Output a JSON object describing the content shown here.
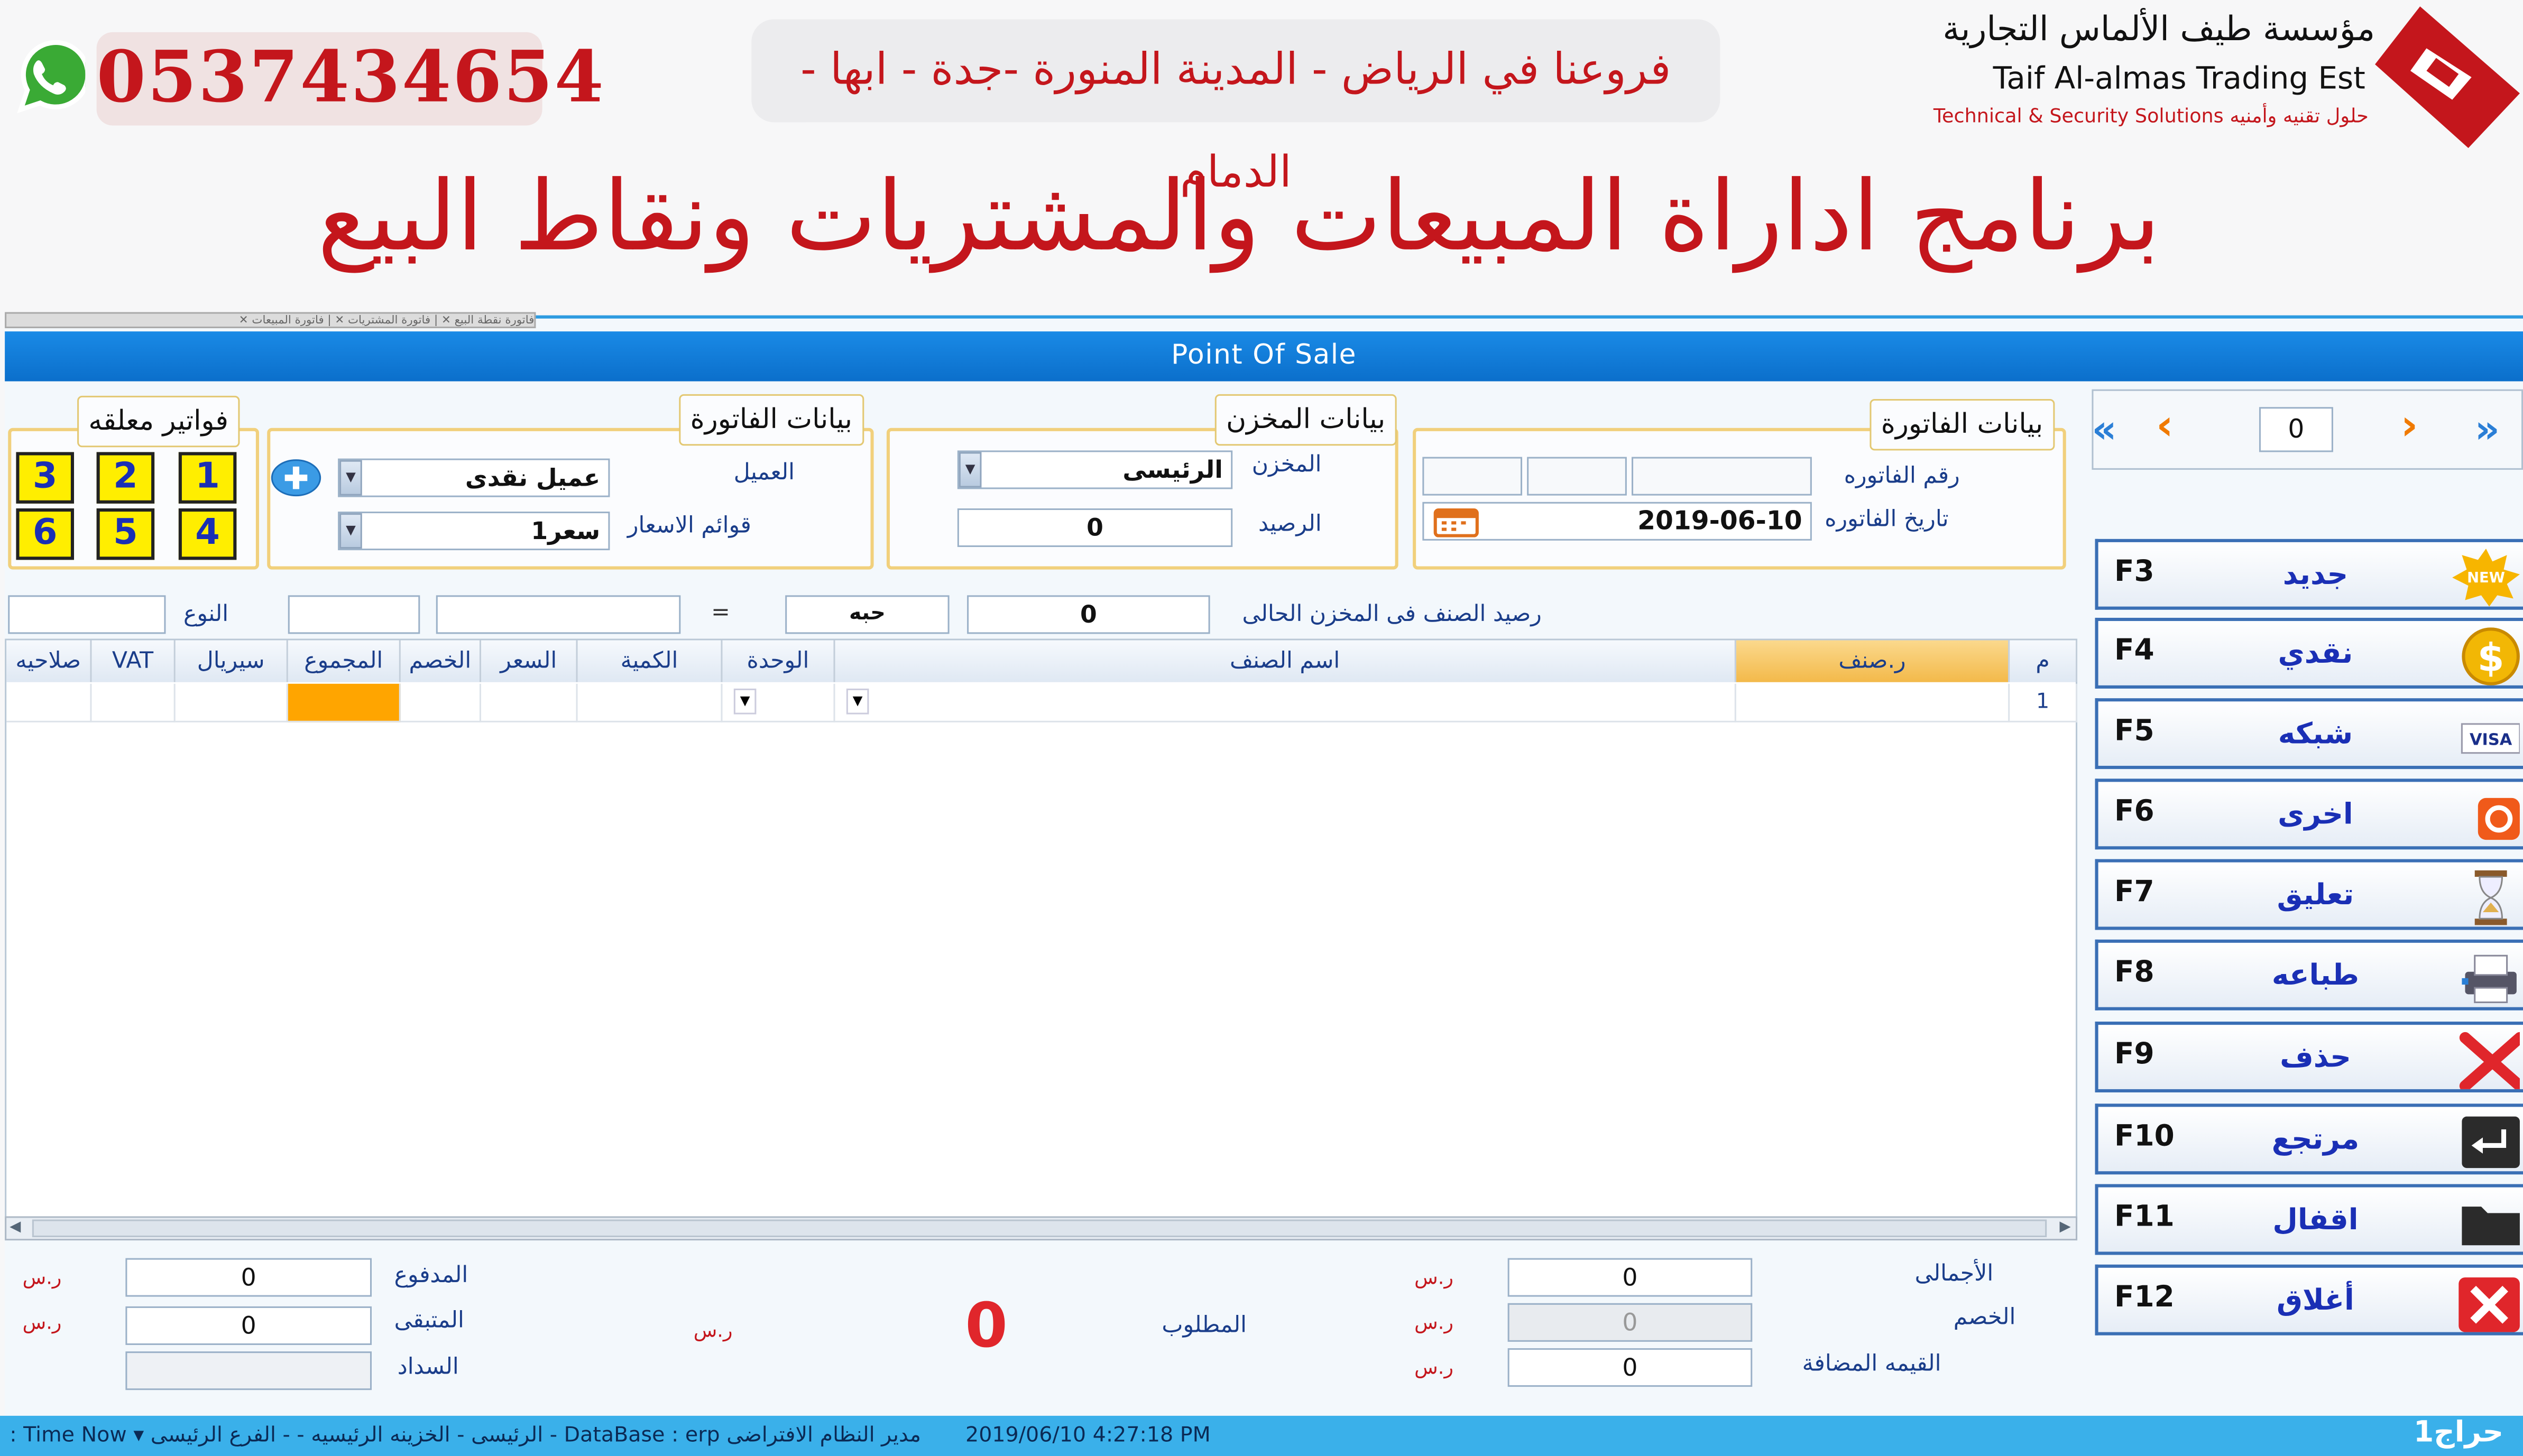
{
  "banner": {
    "phone": "0537434654",
    "branches": "فروعنا في الرياض - المدينة المنورة -جدة - ابها - الدمام",
    "company_ar": "مؤسسة طيف الألماس التجارية",
    "company_en": "Taif Al-almas Trading Est",
    "tagline": "Technical & Security Solutions حلول تقنيه وأمنيه",
    "main_title": "برنامج اداراة المبيعات والمشتريات ونقاط البيع",
    "icons": {
      "whatsapp": "whatsapp-icon",
      "logo": "company-logo"
    },
    "colors": {
      "brand_red": "#c4161c",
      "whatsapp_green": "#3aaa35"
    }
  },
  "window": {
    "tabs_text": "فاتورة نقطة البيع ✕ | فاتورة المشتريات ✕ | فاتورة المبيعات ✕",
    "title": "Point Of Sale",
    "title_color": "#0b6fcb"
  },
  "suspended": {
    "title": "فواتير معلقه",
    "buttons": [
      "1",
      "2",
      "3",
      "4",
      "5",
      "6"
    ]
  },
  "invoice_client": {
    "title": "بيانات الفاتورة",
    "customer_label": "العميل",
    "customer_value": "عميل نقدى",
    "pricelist_label": "قوائم الاسعار",
    "pricelist_value": "سعر1"
  },
  "warehouse": {
    "title": "بيانات المخزن",
    "store_label": "المخزن",
    "store_value": "الرئيسى",
    "balance_label": "الرصيد",
    "balance_value": "0"
  },
  "invoice_info": {
    "title": "بيانات الفاتورة",
    "number_label": "رقم الفاتوره",
    "date_label": "تاريخ الفاتوره",
    "date_value": "2019-06-10"
  },
  "item_bar": {
    "type_label": "النوع",
    "eq": "=",
    "unit_value": "حبه",
    "stock_value": "0",
    "stock_label": "رصيد الصنف فى المخزن الحالى"
  },
  "grid": {
    "columns": [
      "م",
      "ر.صنف",
      "اسم الصنف",
      "الوحدة",
      "الكمية",
      "السعر",
      "الخصم",
      "المجموع",
      "سيريال",
      "VAT",
      "صلاحيه"
    ],
    "rows": [
      {
        "index": "1"
      }
    ]
  },
  "nav": {
    "counter": "0"
  },
  "fbuttons": [
    {
      "key": "F3",
      "label": "جديد",
      "icon": "new-badge-icon"
    },
    {
      "key": "F4",
      "label": "نقدي",
      "icon": "dollar-coin-icon"
    },
    {
      "key": "F5",
      "label": "شبكه",
      "icon": "visa-card-icon",
      "icon_text": "VISA"
    },
    {
      "key": "F6",
      "label": "اخرى",
      "icon": "orange-record-icon"
    },
    {
      "key": "F7",
      "label": "تعليق",
      "icon": "hourglass-icon"
    },
    {
      "key": "F8",
      "label": "طباعه",
      "icon": "printer-icon"
    },
    {
      "key": "F9",
      "label": "حذف",
      "icon": "red-x-icon"
    },
    {
      "key": "F10",
      "label": "مرتجع",
      "icon": "return-arrow-icon"
    },
    {
      "key": "F11",
      "label": "اقفال",
      "icon": "folder-icon"
    },
    {
      "key": "F12",
      "label": "أغلاق",
      "icon": "close-x-icon"
    }
  ],
  "totals": {
    "currency": "ر.س",
    "paid_label": "المدفوع",
    "paid_value": "0",
    "remaining_label": "المتبقى",
    "remaining_value": "0",
    "payment_label": "السداد",
    "required_label": "المطلوب",
    "required_value": "0",
    "total_label": "الأجمالى",
    "total_value": "0",
    "discount_label": "الخصم",
    "discount_value": "0",
    "vat_label": "القيمه المضافة",
    "vat_value": "0"
  },
  "status": {
    "left_text": "مدير النظام الافتراضى DataBase : erp - الرئيسى - الخزينه الرئيسيه - - الفرع الرئيسى ▾ Time Now :",
    "time": "2019/06/10 4:27:18 PM",
    "right_text": "حراج1"
  }
}
